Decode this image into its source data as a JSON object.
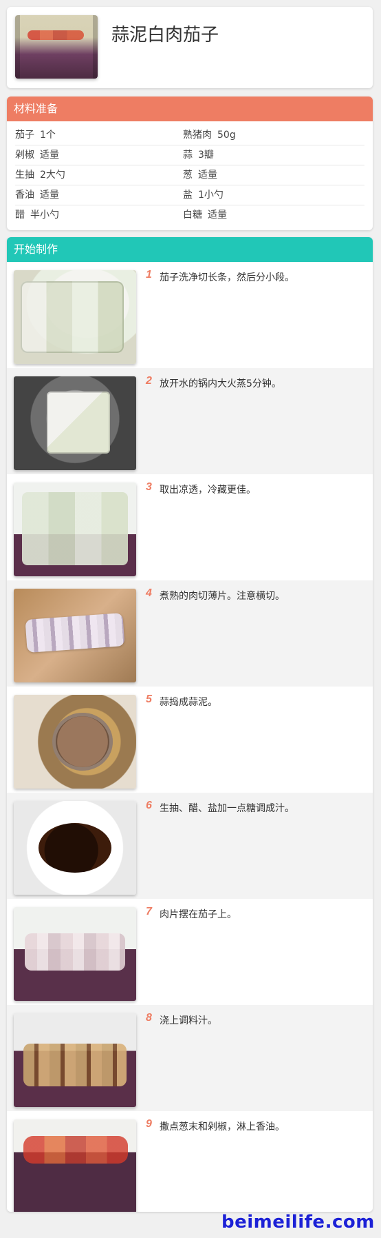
{
  "page": {
    "title": "蒜泥白肉茄子",
    "watermark": "beimeilife.com"
  },
  "sections": {
    "ingredients_title": "材料准备",
    "steps_title": "开始制作"
  },
  "ingredients": [
    {
      "left": {
        "name": "茄子",
        "qty": "1个"
      },
      "right": {
        "name": "熟猪肉",
        "qty": "50g"
      }
    },
    {
      "left": {
        "name": "剁椒",
        "qty": "适量"
      },
      "right": {
        "name": "蒜",
        "qty": "3瓣"
      }
    },
    {
      "left": {
        "name": "生抽",
        "qty": "2大勺"
      },
      "right": {
        "name": "葱",
        "qty": "适量"
      }
    },
    {
      "left": {
        "name": "香油",
        "qty": "适量"
      },
      "right": {
        "name": "盐",
        "qty": "1小勺"
      }
    },
    {
      "left": {
        "name": "醋",
        "qty": "半小勺"
      },
      "right": {
        "name": "白糖",
        "qty": "适量"
      }
    }
  ],
  "steps": [
    {
      "num": "1",
      "text": "茄子洗净切长条，然后分小段。",
      "icon": "eggplant-strips"
    },
    {
      "num": "2",
      "text": "放开水的锅内大火蒸5分钟。",
      "icon": "steamer-pot"
    },
    {
      "num": "3",
      "text": "取出凉透，冷藏更佳。",
      "icon": "cooled-eggplant"
    },
    {
      "num": "4",
      "text": "煮熟的肉切薄片。注意横切。",
      "icon": "sliced-pork"
    },
    {
      "num": "5",
      "text": "蒜捣成蒜泥。",
      "icon": "garlic-paste"
    },
    {
      "num": "6",
      "text": "生抽、醋、盐加一点糖调成汁。",
      "icon": "sauce-bowl"
    },
    {
      "num": "7",
      "text": "肉片摆在茄子上。",
      "icon": "pork-on-eggplant"
    },
    {
      "num": "8",
      "text": "浇上调料汁。",
      "icon": "poured-sauce"
    },
    {
      "num": "9",
      "text": "撒点葱末和剁椒，淋上香油。",
      "icon": "final-plate"
    }
  ]
}
